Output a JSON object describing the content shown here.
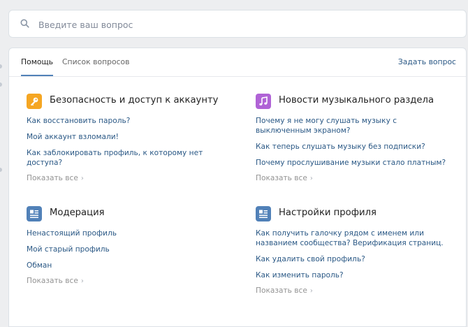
{
  "search": {
    "placeholder": "Введите ваш вопрос"
  },
  "tabs": {
    "help": "Помощь",
    "list": "Список вопросов"
  },
  "ask_link": "Задать вопрос",
  "sections": [
    {
      "title": "Безопасность и доступ к аккаунту",
      "icon": "key-icon",
      "color": "#f5a623",
      "questions": [
        "Как восстановить пароль?",
        "Мой аккаунт взломали!",
        "Как заблокировать профиль, к которому нет доступа?"
      ],
      "show_all": "Показать все"
    },
    {
      "title": "Новости музыкального раздела",
      "icon": "music-note-icon",
      "color": "#b063d6",
      "questions": [
        "Почему я не могу слушать музыку с выключенным экраном?",
        "Как теперь слушать музыку без подписки?",
        "Почему прослушивание музыки стало платным?"
      ],
      "show_all": "Показать все"
    },
    {
      "title": "Модерация",
      "icon": "article-icon",
      "color": "#5181b8",
      "questions": [
        "Ненастоящий профиль",
        "Мой старый профиль",
        "Обман"
      ],
      "show_all": "Показать все"
    },
    {
      "title": "Настройки профиля",
      "icon": "article-icon",
      "color": "#5181b8",
      "questions": [
        "Как получить галочку рядом с именем или названием сообщества? Верификация страниц.",
        "Как удалить свой профиль?",
        "Как изменить пароль?"
      ],
      "show_all": "Показать все"
    }
  ]
}
